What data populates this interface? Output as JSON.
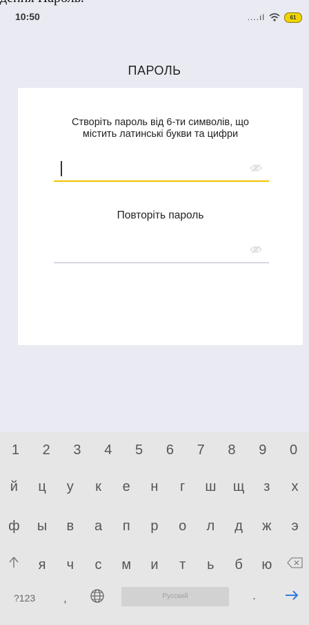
{
  "caption": "дення Пароль.",
  "status_bar": {
    "time": "10:50",
    "signal_text": "....ıl",
    "battery": "61"
  },
  "header": {
    "title": "ПАРОЛЬ"
  },
  "form": {
    "instruction_line1": "Створіть пароль від 6-ти символів, що",
    "instruction_line2": "містить латинські букви та цифри",
    "password_value": "",
    "repeat_label": "Повторіть пароль",
    "repeat_value": ""
  },
  "keyboard": {
    "number_row": [
      "1",
      "2",
      "3",
      "4",
      "5",
      "6",
      "7",
      "8",
      "9",
      "0"
    ],
    "row1": [
      "й",
      "ц",
      "у",
      "к",
      "е",
      "н",
      "г",
      "ш",
      "щ",
      "з",
      "х"
    ],
    "row2": [
      "ф",
      "ы",
      "в",
      "а",
      "п",
      "р",
      "о",
      "л",
      "д",
      "ж",
      "э"
    ],
    "row3": [
      "я",
      "ч",
      "с",
      "м",
      "и",
      "т",
      "ь",
      "б",
      "ю"
    ],
    "symbols_key": "?123",
    "comma_key": ",",
    "space_label": "Русский",
    "period_key": ".",
    "icons": {
      "shift": "shift-icon",
      "backspace": "backspace-icon",
      "globe": "globe-icon",
      "enter": "enter-arrow-icon",
      "eye": "eye-icon"
    },
    "accent_color": "#2f7be0"
  }
}
